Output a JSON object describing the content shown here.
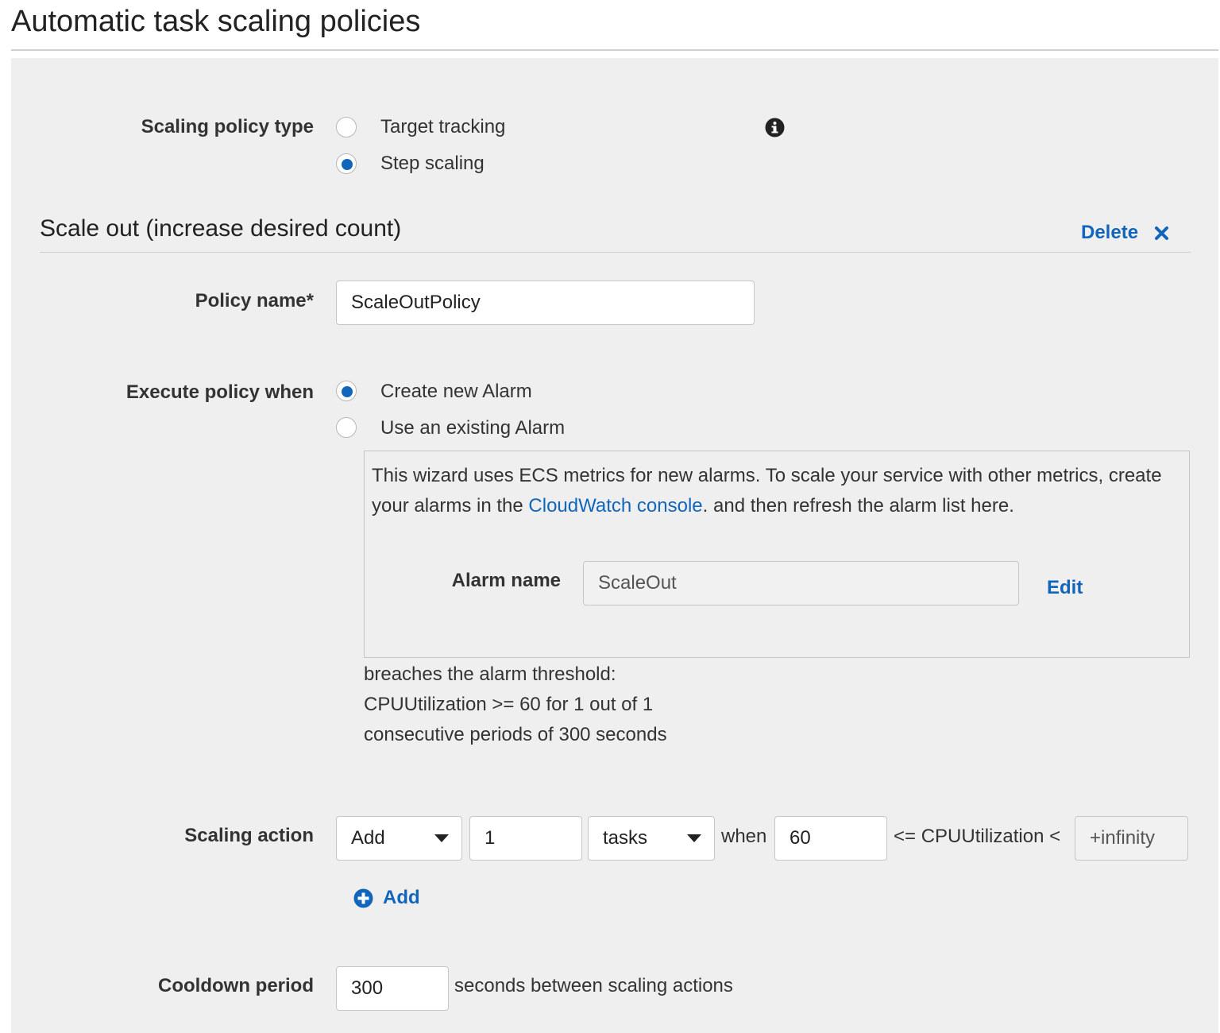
{
  "page": {
    "title": "Automatic task scaling policies"
  },
  "policy_type": {
    "label": "Scaling policy type",
    "options": [
      {
        "label": "Target tracking",
        "selected": false
      },
      {
        "label": "Step scaling",
        "selected": true
      }
    ],
    "info_icon": "info-circle-icon"
  },
  "scale_out": {
    "title": "Scale out (increase desired count)",
    "delete_label": "Delete",
    "delete_icon": "close-icon",
    "policy_name": {
      "label": "Policy name*",
      "value": "ScaleOutPolicy"
    },
    "execute": {
      "label": "Execute policy when",
      "options": [
        {
          "label": "Create new Alarm",
          "selected": true
        },
        {
          "label": "Use an existing Alarm",
          "selected": false
        }
      ]
    },
    "info": {
      "text_before": "This wizard uses ECS metrics for new alarms. To scale your service with other metrics, create your alarms in the ",
      "link": "CloudWatch console",
      "text_after": ". and then refresh the alarm list here."
    },
    "alarm": {
      "label": "Alarm name",
      "value": "ScaleOut",
      "edit_label": "Edit"
    },
    "threshold": {
      "line1": "breaches the alarm threshold:",
      "line2": "CPUUtilization >= 60 for 1 out of 1",
      "line3": "consecutive periods of 300 seconds"
    },
    "scaling_action": {
      "label": "Scaling action",
      "action": "Add",
      "amount": "1",
      "unit": "tasks",
      "when_label": "when",
      "lower": "60",
      "metric_label": "<= CPUUtilization <",
      "upper": "+infinity",
      "add_label": "Add",
      "add_icon": "plus-circle-icon"
    },
    "cooldown": {
      "label": "Cooldown period",
      "value": "300",
      "suffix": "seconds between scaling actions"
    }
  },
  "colors": {
    "accent": "#1166bb",
    "panel": "#efefef",
    "border": "#c6c6c6"
  }
}
